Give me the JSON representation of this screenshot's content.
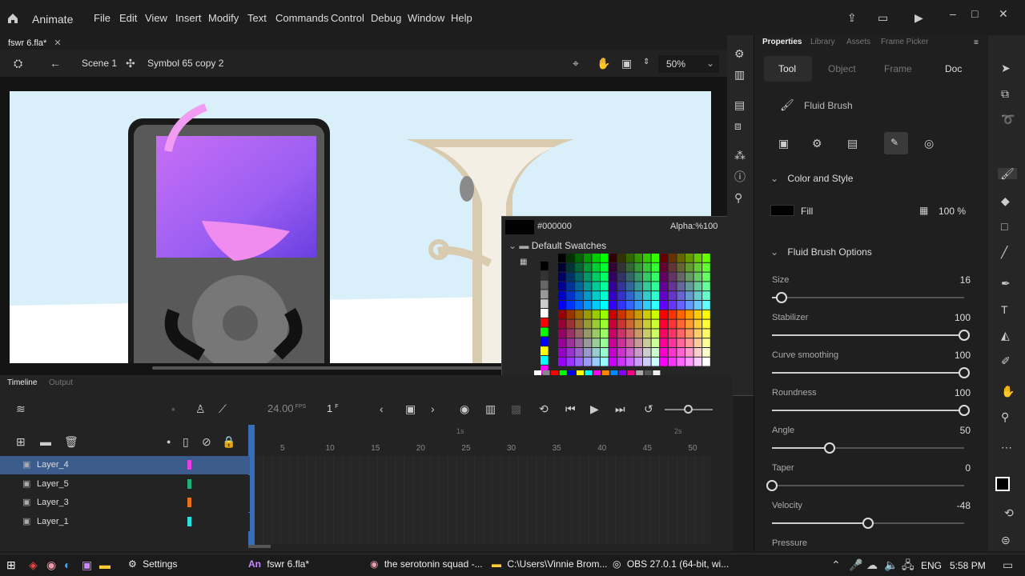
{
  "app": {
    "name": "Animate"
  },
  "menu": [
    "File",
    "Edit",
    "View",
    "Insert",
    "Modify",
    "Text",
    "Commands",
    "Control",
    "Debug",
    "Window",
    "Help"
  ],
  "document_tab": {
    "name": "fswr 6.fla*"
  },
  "editbar": {
    "scene": "Scene 1",
    "symbol": "Symbol 65 copy 2",
    "zoom": "50%"
  },
  "props": {
    "tabs": [
      "Properties",
      "Library",
      "Assets",
      "Frame Picker"
    ],
    "subtabs": [
      "Tool",
      "Object",
      "Frame",
      "Doc"
    ],
    "tool_name": "Fluid Brush",
    "color_section": "Color and Style",
    "fill_label": "Fill",
    "fill_alpha": "100 %",
    "options_section": "Fluid Brush Options",
    "sliders": [
      {
        "label": "Size",
        "value": "16",
        "fraction": 0.05
      },
      {
        "label": "Stabilizer",
        "value": "100",
        "fraction": 1.0
      },
      {
        "label": "Curve smoothing",
        "value": "100",
        "fraction": 1.0
      },
      {
        "label": "Roundness",
        "value": "100",
        "fraction": 1.0
      },
      {
        "label": "Angle",
        "value": "50",
        "fraction": 0.3
      },
      {
        "label": "Taper",
        "value": "0",
        "fraction": 0.0
      },
      {
        "label": "Velocity",
        "value": "-48",
        "fraction": 0.5
      },
      {
        "label": "Pressure",
        "value": "",
        "fraction": 0.0
      }
    ]
  },
  "swatches": {
    "hex": "#000000",
    "alpha": "Alpha:%100",
    "folder": "Default Swatches"
  },
  "timeline": {
    "tabs": [
      "Timeline",
      "Output"
    ],
    "fps": "24.00",
    "fps_unit": "FPS",
    "frame": "1",
    "frame_unit": "F",
    "ruler": [
      "5",
      "10",
      "15",
      "20",
      "25",
      "30",
      "35",
      "40",
      "45",
      "50"
    ],
    "time_marks": [
      "1s",
      "2s"
    ],
    "layers": [
      {
        "name": "Layer_4",
        "color": "#e83ee8",
        "selected": true
      },
      {
        "name": "Layer_5",
        "color": "#20b07a",
        "selected": false
      },
      {
        "name": "Layer_3",
        "color": "#e8711a",
        "selected": false
      },
      {
        "name": "Layer_1",
        "color": "#27e0e0",
        "selected": false
      }
    ]
  },
  "taskbar": {
    "settings": "Settings",
    "items": [
      "fswr 6.fla*",
      "the serotonin squad -...",
      "C:\\Users\\Vinnie Brom...",
      "OBS 27.0.1 (64-bit, wi..."
    ],
    "lang": "ENG",
    "time": "5:58 PM"
  }
}
